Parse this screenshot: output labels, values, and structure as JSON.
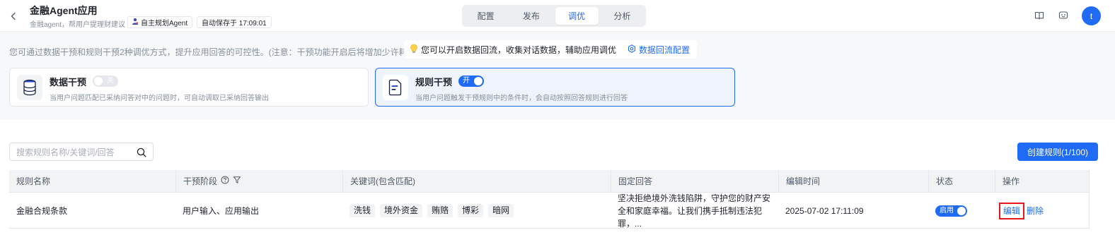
{
  "header": {
    "app_title": "金融Agent应用",
    "app_subtitle": "金融agent，帮用户提理财建议",
    "agent_tag": "自主规划Agent",
    "autosave": "自动保存于 17:09:01",
    "tabs": [
      {
        "label": "配置"
      },
      {
        "label": "发布"
      },
      {
        "label": "调优",
        "active": true
      },
      {
        "label": "分析"
      }
    ],
    "avatar_letter": "t"
  },
  "intro": {
    "text": "您可通过数据干预和规则干预2种调优方式，提升应用回答的可控性。(注意：干预功能开启后将增加少许耗时)",
    "tip": "您可以开启数据回流，收集对话数据，辅助应用调优",
    "tip_link": "数据回流配置"
  },
  "cards": {
    "data": {
      "title": "数据干预",
      "toggle_label": "关",
      "toggle_on": false,
      "desc": "当用户问题匹配已采纳问答对中的问题时，可自动调取已采纳回答输出"
    },
    "rule": {
      "title": "规则干预",
      "toggle_label": "开",
      "toggle_on": true,
      "desc": "当用户问题触发干预规则中的条件时，会自动按照回答规则进行回答"
    }
  },
  "toolbar": {
    "search_placeholder": "搜索规则名称/关键词/回答",
    "create_label": "创建规则(1/100)"
  },
  "table": {
    "columns": {
      "name": "规则名称",
      "stage": "干预阶段",
      "keywords": "关键词(包含匹配)",
      "answer": "固定回答",
      "time": "编辑时间",
      "status": "状态",
      "ops": "操作"
    },
    "rows": [
      {
        "name": "金融合规条款",
        "stage": "用户输入、应用输出",
        "keywords": [
          "洗钱",
          "境外资金",
          "贿赂",
          "博彩",
          "暗网"
        ],
        "answer": "坚决拒绝境外洗钱陷阱，守护您的财产安全和家庭幸福。让我们携手抵制违法犯罪，...",
        "time": "2025-07-02 17:11:09",
        "status_label": "启用",
        "status_on": true,
        "edit_label": "编辑",
        "delete_label": "删除"
      }
    ]
  },
  "colors": {
    "accent": "#1f6bf5",
    "highlight_border": "#e6161b"
  }
}
